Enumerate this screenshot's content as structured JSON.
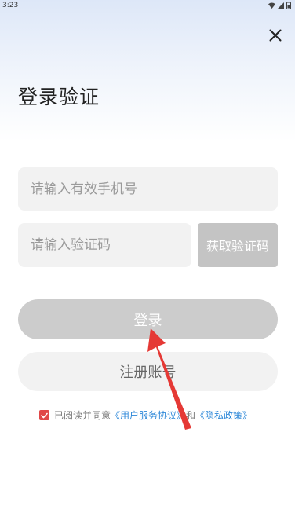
{
  "status_bar": {
    "time": "3:23"
  },
  "header": {
    "title": "登录验证"
  },
  "form": {
    "phone_placeholder": "请输入有效手机号",
    "code_placeholder": "请输入验证码",
    "get_code_label": "获取验证码",
    "login_label": "登录",
    "register_label": "注册账号"
  },
  "agreement": {
    "checked": true,
    "prefix": "已阅读并同意",
    "user_agreement": "《用户服务协议》",
    "conjunction": "和",
    "privacy_policy": "《隐私政策》"
  },
  "icons": {
    "close": "close-icon",
    "wifi": "wifi-icon",
    "signal": "signal-icon",
    "battery": "battery-icon",
    "check": "check-icon"
  },
  "colors": {
    "checkbox": "#e04848",
    "link": "#2c87d8",
    "annotation_arrow": "#e53935",
    "button_disabled": "#cccccc"
  }
}
